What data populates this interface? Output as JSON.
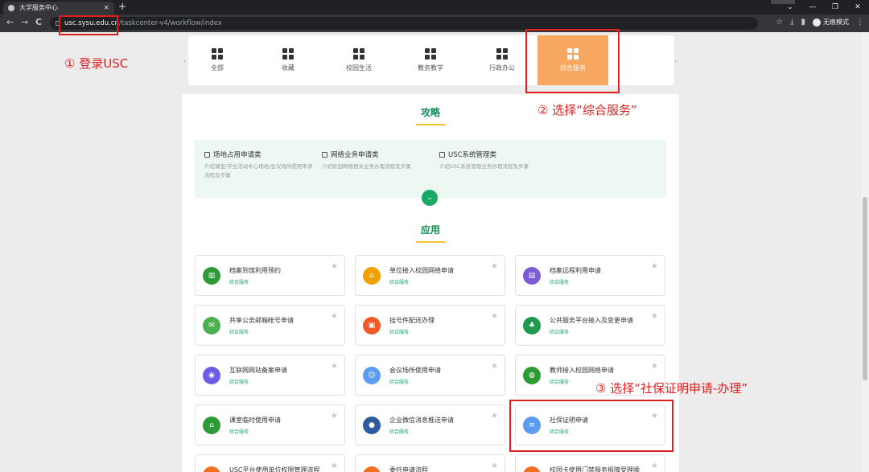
{
  "browser": {
    "tab_title": "大学服务中心",
    "tab_close": "×",
    "new_tab": "+",
    "url_host": "usc.sysu.edu.cn",
    "url_path": "/taskcenter-v4/workflow/index",
    "incognito_label": "无痕模式",
    "win_min": "—",
    "win_restore": "❐",
    "win_close": "✕",
    "back": "←",
    "forward": "→",
    "reload": "C"
  },
  "nav": {
    "left_arrow": "‹",
    "right_arrow": "›",
    "categories": [
      {
        "label": "全部"
      },
      {
        "label": "收藏"
      },
      {
        "label": "校园生活"
      },
      {
        "label": "教务教学"
      },
      {
        "label": "行政办公"
      },
      {
        "label": "综合服务"
      }
    ]
  },
  "guide_section": {
    "title": "攻略",
    "items": [
      {
        "title": "场地占用申请类",
        "desc": "介绍课室/学生活动中心场地/会议场所使用申请流程及步骤"
      },
      {
        "title": "网络业务申请类",
        "desc": "介绍校园网络相关业务办理流程及步骤"
      },
      {
        "title": "USC系统管理类",
        "desc": "介绍USC系统管理业务办理流程及步骤"
      }
    ],
    "expand_glyph": "⌄"
  },
  "apps_section": {
    "title": "应用",
    "star": "★",
    "apps": [
      {
        "name": "档案到馆利用预约",
        "sub": "综合服务",
        "color": "#2e9a35",
        "glyph": "▥"
      },
      {
        "name": "单位接入校园网络申请",
        "sub": "综合服务",
        "color": "#f0a000",
        "glyph": "⌂"
      },
      {
        "name": "档案远程利用申请",
        "sub": "综合服务",
        "color": "#7b5cd6",
        "glyph": "▤"
      },
      {
        "name": "共享公务邮箱帐号申请",
        "sub": "综合服务",
        "color": "#4caf50",
        "glyph": "✉"
      },
      {
        "name": "挂号件配送办理",
        "sub": "综合服务",
        "color": "#f05a28",
        "glyph": "▣"
      },
      {
        "name": "公共服务平台接入及变更申请",
        "sub": "综合服务",
        "color": "#1d9a50",
        "glyph": "♣"
      },
      {
        "name": "互联网网站备案申请",
        "sub": "综合服务",
        "color": "#6c5ce7",
        "glyph": "◉"
      },
      {
        "name": "会议场所使用申请",
        "sub": "综合服务",
        "color": "#5b9bf0",
        "glyph": "☺"
      },
      {
        "name": "教师接入校园网络申请",
        "sub": "综合服务",
        "color": "#2e9a35",
        "glyph": "◍"
      },
      {
        "name": "课室临时使用申请",
        "sub": "综合服务",
        "color": "#2e9a35",
        "glyph": "⌂"
      },
      {
        "name": "企业微信消息推送申请",
        "sub": "综合服务",
        "color": "#2d5b9e",
        "glyph": "●"
      },
      {
        "name": "社保证明申请",
        "sub": "综合服务",
        "color": "#5b9bf0",
        "glyph": "≡"
      },
      {
        "name": "USC平台使用单位权限管理流程",
        "sub": "",
        "color": "#f07020",
        "glyph": "●"
      },
      {
        "name": "委托申请流程",
        "sub": "",
        "color": "#f07020",
        "glyph": "●"
      },
      {
        "name": "校园卡使用门禁服务报障受理顺",
        "sub": "",
        "color": "#f07020",
        "glyph": "●"
      }
    ]
  },
  "annotations": {
    "step1": "① 登录USC",
    "step2": "② 选择“综合服务”",
    "step3": "③ 选择“社保证明申请-办理”"
  },
  "colors": {
    "accent_green": "#0a8f54",
    "active_tab": "#f7a760",
    "annotation_red": "#e02020"
  }
}
